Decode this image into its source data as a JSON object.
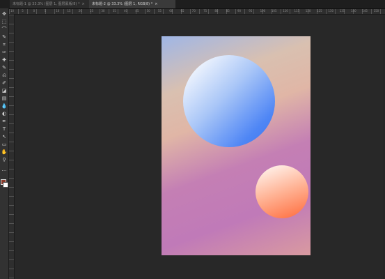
{
  "tabs": [
    {
      "label": "未标题-1 @ 33.3% (图层 1, 图层蒙版/8) *",
      "close": "×"
    },
    {
      "label": "未标题-2 @ 33.3% (图层 1, RGB/8) *",
      "close": "×"
    }
  ],
  "toolbar": {
    "tools": [
      "move-icon",
      "marquee-icon",
      "lasso-icon",
      "quick-select-icon",
      "crop-icon",
      "eyedropper-icon",
      "healing-icon",
      "brush-icon",
      "stamp-icon",
      "history-brush-icon",
      "eraser-icon",
      "gradient-icon",
      "blur-icon",
      "dodge-icon",
      "pen-icon",
      "type-icon",
      "path-select-icon",
      "shape-icon",
      "hand-icon",
      "zoom-icon",
      "more-icon"
    ],
    "glyphs": [
      "✥",
      "⬚",
      "⌒",
      "✎",
      "⌗",
      "✑",
      "✚",
      "✎",
      "⎌",
      "✐",
      "◪",
      "▤",
      "💧",
      "◐",
      "✒",
      "T",
      "↖",
      "▭",
      "✋",
      "⚲",
      "…"
    ],
    "foreground_color": "#8a3a2a",
    "background_color": "#ffffff"
  },
  "ruler": {
    "top_labels": [
      "10",
      "5",
      "0",
      "5",
      "10",
      "15",
      "20",
      "25",
      "30",
      "35",
      "40",
      "45",
      "50",
      "55",
      "60",
      "65",
      "70",
      "75",
      "80",
      "85",
      "90",
      "95",
      "100",
      "105",
      "110",
      "115",
      "120",
      "125",
      "130",
      "135",
      "140",
      "145",
      "150"
    ]
  },
  "canvas": {
    "background_gradient": [
      "#9fb6e6",
      "#e0b6a6",
      "#c07ab8",
      "#d99aa0"
    ],
    "circle_large_colors": [
      "#ffffff",
      "#3a76f0"
    ],
    "circle_small_colors": [
      "#fff4ee",
      "#ff6a3a"
    ]
  }
}
